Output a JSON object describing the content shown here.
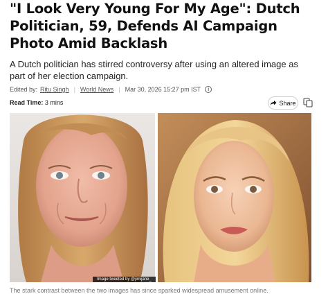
{
  "article": {
    "headline": "\"I Look Very Young For My Age\": Dutch Politician, 59, Defends AI Campaign Photo Amid Backlash",
    "summary": "A Dutch politician has stirred controversy after using an altered image as part of her election campaign.",
    "meta": {
      "edited_by_label": "Edited by:",
      "author": "Ritu Singh",
      "category": "World News",
      "timestamp": "Mar 30, 2026 15:27 pm IST"
    },
    "read_time": {
      "label": "Read Time:",
      "value": "3 mins"
    },
    "share_label": "Share",
    "image_credit": "Image tweeted by @jimijane_",
    "caption": "The stark contrast between the two images has since sparked widespread amusement online."
  },
  "icons": {
    "info": "info-icon",
    "share": "share-icon",
    "copy": "copy-icon"
  }
}
